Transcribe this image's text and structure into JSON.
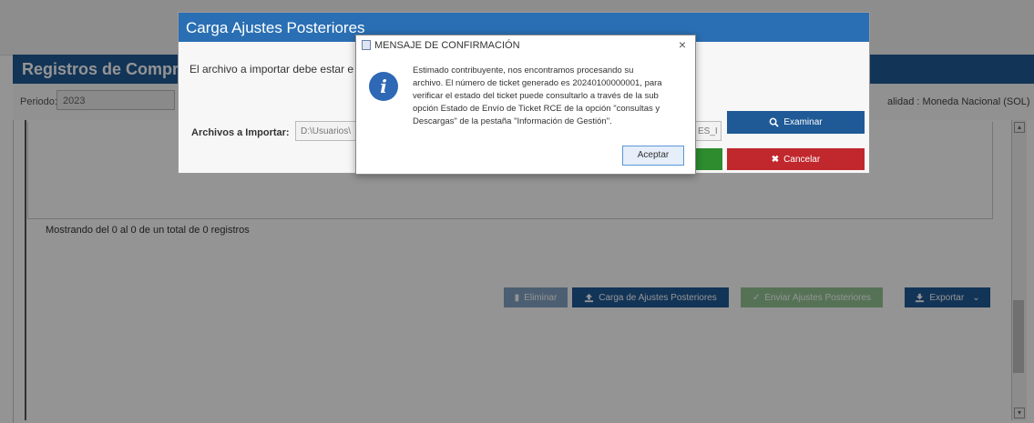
{
  "page": {
    "title": "Registros de Compras",
    "periodo_label": "Periodo:",
    "periodo_value": "2023",
    "moneda": "alidad : Moneda Nacional (SOL)",
    "showing": "Mostrando del 0 al 0 de un total de 0 registros",
    "buttons": {
      "eliminar": "Eliminar",
      "carga": "Carga de Ajustes Posteriores",
      "enviar": "Enviar Ajustes Posteriores",
      "exportar": "Exportar"
    }
  },
  "carga_dialog": {
    "title": "Carga Ajustes Posteriores",
    "message": "El archivo a importar debe estar e",
    "archivos_label": "Archivos a Importar:",
    "file_value": "D:\\Usuarios\\",
    "file_suffix": "ES_I",
    "examinar": "Examinar",
    "cancelar": "Cancelar"
  },
  "confirm_dialog": {
    "title": "MENSAJE DE CONFIRMACIÓN",
    "close": "×",
    "message_lines": [
      "Estimado contribuyente, nos encontramos procesando su",
      "archivo. El número de ticket generado es 20240100000001, para",
      "verificar el estado del ticket puede consultarlo a través de la sub",
      "opción Estado de Envío de Ticket RCE de la opción \"consultas y",
      "Descargas\" de la pestaña \"Información de Gestión\"."
    ],
    "accept": "Aceptar"
  },
  "icons": {
    "info": "info-icon",
    "search": "search-icon",
    "cancel": "x-icon",
    "upload": "upload-icon",
    "check": "check-icon",
    "export": "export-icon"
  },
  "colors": {
    "primary": "#1f5a96",
    "dialog_header": "#2a6fb3",
    "examinar": "#1f5a96",
    "cancelar": "#c0282d",
    "green": "#2e8b2e",
    "info_icon": "#2f68b5"
  }
}
